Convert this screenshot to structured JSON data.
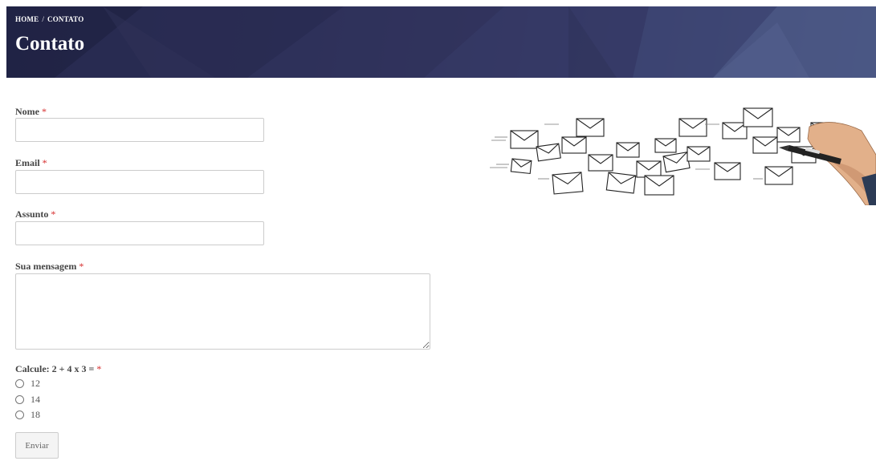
{
  "header": {
    "breadcrumb": [
      "HOME",
      "/",
      "CONTATO"
    ],
    "title": "Contato"
  },
  "form": {
    "fields": [
      {
        "label": "Nome",
        "required_mark": "*",
        "value": ""
      },
      {
        "label": "Email",
        "required_mark": "*",
        "value": ""
      },
      {
        "label": "Assunto",
        "required_mark": "*",
        "value": ""
      },
      {
        "label": "Sua mensagem",
        "required_mark": "*",
        "value": ""
      }
    ],
    "captcha": {
      "question": "Calcule: 2 + 4 x 3 =",
      "required_mark": "*",
      "options": [
        "12",
        "14",
        "18"
      ]
    },
    "submit_label": "Enviar"
  },
  "illustration": {
    "icon": "hand-drawing-envelopes-icon"
  },
  "colors": {
    "hero_dark": "#24264a",
    "hero_light": "#4a5683",
    "required": "#d62b2b"
  }
}
